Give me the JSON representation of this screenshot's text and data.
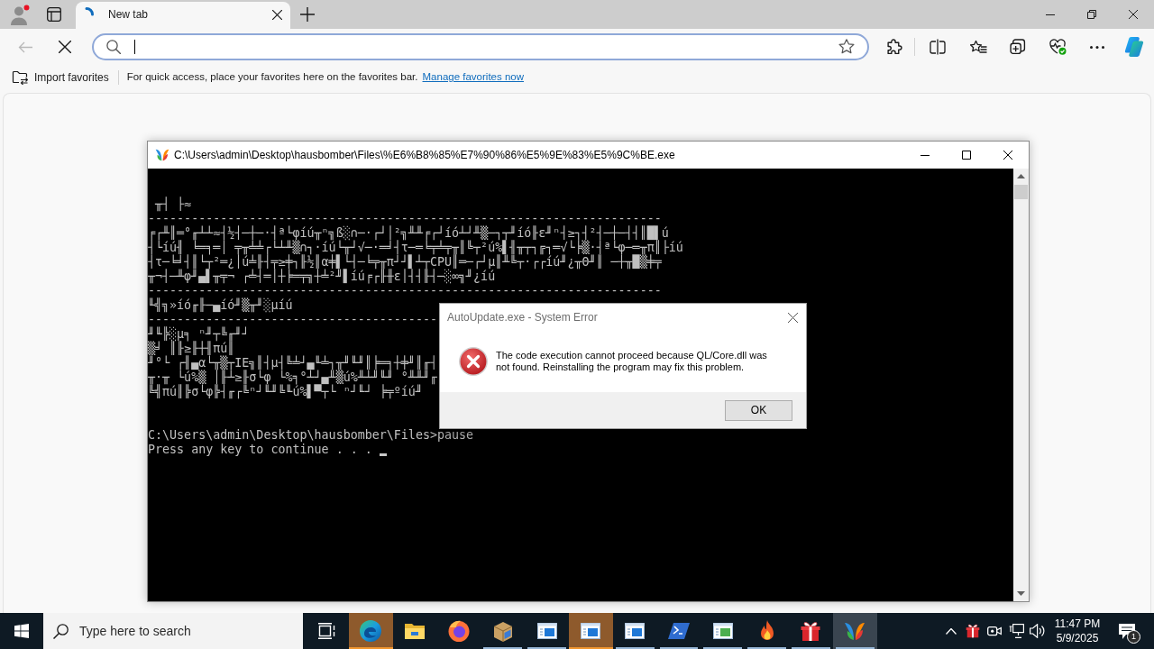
{
  "browser": {
    "tabs": [
      {
        "title": "New tab",
        "selected": true,
        "loading": true
      }
    ],
    "navigation": {
      "back_disabled": true,
      "loading": true
    },
    "address_bar": {
      "focused": true
    },
    "favorites_bar": {
      "import_label": "Import favorites",
      "hint": "For quick access, place your favorites here on the favorites bar.",
      "link": "Manage favorites now"
    }
  },
  "console_window": {
    "title": "C:\\Users\\admin\\Desktop\\hausbomber\\Files\\%E6%B8%85%E7%90%86%E5%9E%83%E5%9C%BE.exe",
    "output_blocks": [
      {
        "lines": [
          " ╥┤ ├≈",
          "-----------------------------------------------------------------------",
          "╒┌╨║═°╓┴┴≈┤½┤─┼─·┤ª└φíú╥ⁿ╗ß░∩─·┌┘│²╗╨╨╒┌┘íó┴┘╨▒─┐┬╜íó╟ε╜ⁿ┤≥┐┤²┤─┼─┤┤║█▌ú",
          "┤└íú╢ ╘═╕═│ ╤╥╧╧┌└┴╨▒∩┐·íú└╥┘√─·═╛┤τ─═╘╤╧╤╥║╚┬²ú%▌╢╥┬┐╔┐═√└╞▒·┤ª└φ─═╥π║├íú",
          "┤τ─╘╛┤║└┬²═¿│ú╧╟┤╤≥╪┐╟½║α╪▌└┤─╘╤╥π┘┘▌┴┬CPU║═─┌┘µ║╨╚┬·┌┌íú╜¿╥Θ╜║ ─┼╥█▒╪╤",
          "╥¬┤─╨φ╜▄▌╥╤¬ ┌╧┤═│┼╞═╤╗┼╧²╜▌íú╒┌╟╫ε│┤┤╟┤─░∞╗╜¿íú",
          "-----------------------------------------------------------------------",
          "╙╣╗»íó╓╟─▄íó╜▒╥╜░µíú",
          "----------------------------------------",
          "╜╙╠░µ╕ ⁿ╜┬╚╓╜┘",
          "▒╛ ║╟≥╟┼╢πú║",
          "╜°└ ┌╢▄α└╥▒┬IE╗║┤µ┤╚╧┘▄╙╧┐╥╜╙╜║╞═╕┼╪╜║╓┤",
          "╥·╥ └ú%▒ │╟┴≥╟σ└φ └%╕°┴┘▄╨▒ú%╨┴╜╙╜ °╨╨╜╓",
          "╚╣πú║╠σ└φ╠┤╓┌╚ⁿ┘╙╜╚╙ú%▌▀┬└ ⁿ┘╙┘ ╞╤ºíú╜"
        ]
      },
      {
        "lines": [
          "C:\\Users\\admin\\Desktop\\hausbomber\\Files>pause",
          "Press any key to continue . . ."
        ]
      }
    ],
    "cursor_visible": true
  },
  "dialog": {
    "title": "AutoUpdate.exe - System Error",
    "kind": "error",
    "message": "The code execution cannot proceed because QL/Core.dll was\nnot found. Reinstalling the program may fix this problem.",
    "buttons": [
      {
        "label": "OK"
      }
    ]
  },
  "taskbar": {
    "search": {
      "placeholder": "Type here to search"
    },
    "apps": [
      {
        "kind": "edge",
        "running": true,
        "flashing": true,
        "selected": false
      },
      {
        "kind": "folder",
        "running": false,
        "flashing": false,
        "selected": false
      },
      {
        "kind": "firefox",
        "running": false,
        "flashing": false,
        "selected": false
      },
      {
        "kind": "package",
        "running": true,
        "flashing": false,
        "selected": false
      },
      {
        "kind": "window",
        "running": true,
        "flashing": false,
        "selected": false
      },
      {
        "kind": "window",
        "running": true,
        "flashing": true,
        "selected": false
      },
      {
        "kind": "window",
        "running": true,
        "flashing": false,
        "selected": false
      },
      {
        "kind": "terminal",
        "running": true,
        "flashing": false,
        "selected": false
      },
      {
        "kind": "form",
        "running": true,
        "flashing": false,
        "selected": false
      },
      {
        "kind": "flame",
        "running": true,
        "flashing": false,
        "selected": false
      },
      {
        "kind": "gift",
        "running": true,
        "flashing": false,
        "selected": false
      },
      {
        "kind": "butterfly",
        "running": true,
        "flashing": false,
        "selected": true
      }
    ],
    "tray": [
      {
        "kind": "chevron"
      },
      {
        "kind": "gift"
      },
      {
        "kind": "camera"
      },
      {
        "kind": "network"
      },
      {
        "kind": "volume"
      }
    ],
    "clock": {
      "time": "11:47 PM",
      "date": "5/9/2025"
    },
    "notifications": {
      "count": "1"
    }
  }
}
